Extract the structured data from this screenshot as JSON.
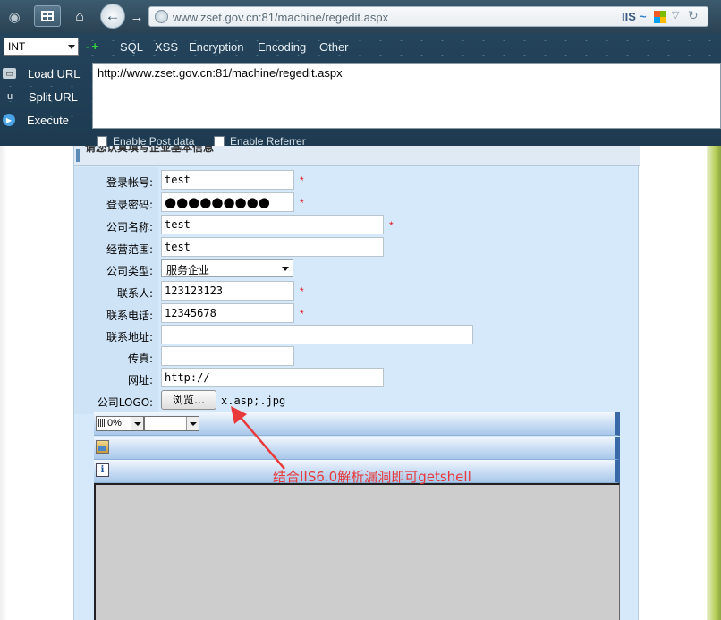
{
  "browser": {
    "url": "www.zset.gov.cn:81/machine/regedit.aspx",
    "server_badge": "IIS",
    "server_badge_wave": "~"
  },
  "hackbar": {
    "type_select": "INT",
    "plus_minus": "-+",
    "menus": [
      "SQL",
      "XSS",
      "Encryption",
      "Encoding",
      "Other"
    ],
    "actions": {
      "load_url": "Load URL",
      "split_url": "Split URL",
      "execute": "Execute"
    },
    "url_value": "http://www.zset.gov.cn:81/machine/regedit.aspx",
    "enable_post": "Enable Post data",
    "enable_referrer": "Enable Referrer"
  },
  "form": {
    "section_title": "请您认真填写企业基本信息",
    "required_mark": "*",
    "fields": {
      "login_account": {
        "label": "登录帐号:",
        "value": "test"
      },
      "login_password": {
        "label": "登录密码:",
        "value": "●●●●●●●●●"
      },
      "company_name": {
        "label": "公司名称:",
        "value": "test"
      },
      "business_scope": {
        "label": "经营范围:",
        "value": "test"
      },
      "company_type": {
        "label": "公司类型:",
        "value": "服务企业"
      },
      "contact_person": {
        "label": "联系人:",
        "value": "123123123"
      },
      "contact_phone": {
        "label": "联系电话:",
        "value": "12345678"
      },
      "contact_address": {
        "label": "联系地址:",
        "value": ""
      },
      "fax": {
        "label": "传真:",
        "value": ""
      },
      "website": {
        "label": "网址:",
        "value": "http://"
      },
      "company_logo": {
        "label": "公司LOGO:",
        "browse_button": "浏览…",
        "file_name": "x.asp;.jpg"
      }
    }
  },
  "editor": {
    "zoom_value": "0%"
  },
  "annotation": {
    "text": "结合IIS6.0解析漏洞即可getshell",
    "color": "#e83a3a"
  },
  "colors": {
    "panel_bg": "#d6e9fa",
    "required": "#e0191e",
    "editor_toolbar": "#a9c7ea"
  }
}
